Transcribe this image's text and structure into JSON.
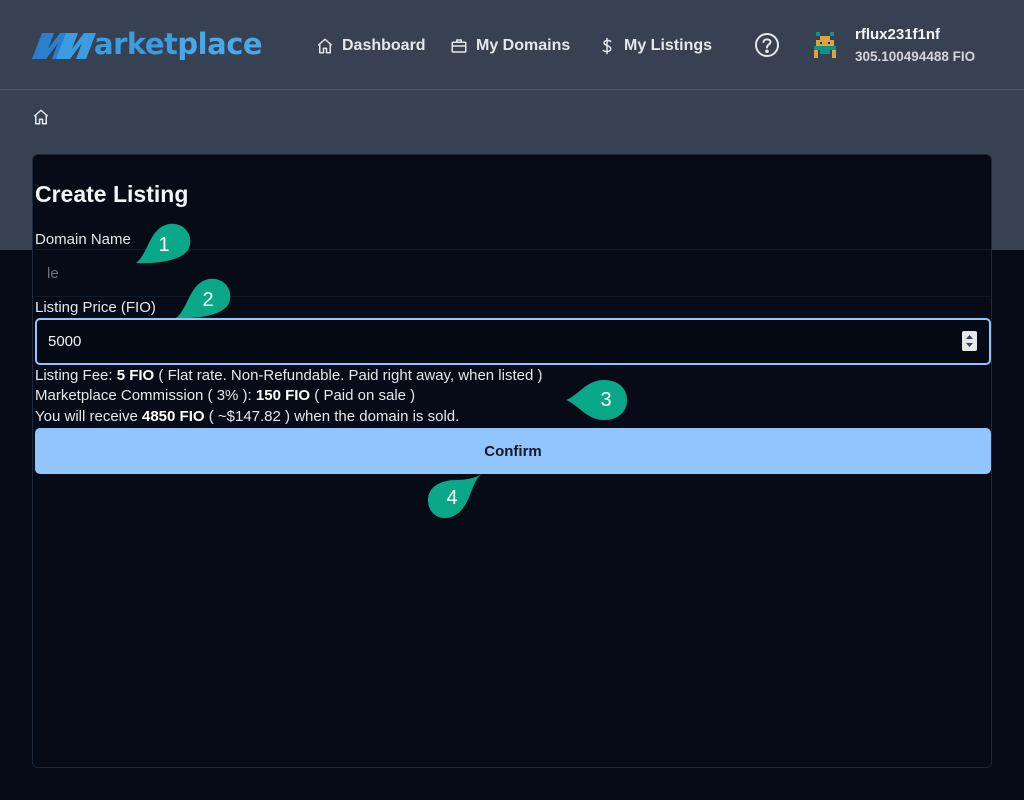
{
  "header": {
    "logo": {
      "text_bold": "arket",
      "text_rest": "place"
    },
    "nav": [
      {
        "label": "Dashboard",
        "icon": "home-icon"
      },
      {
        "label": "My Domains",
        "icon": "briefcase-icon"
      },
      {
        "label": "My Listings",
        "icon": "dollar-icon"
      }
    ],
    "help_icon": "help-circle-icon",
    "user": {
      "name": "rflux231f1nf",
      "balance": "305.100494488 FIO",
      "avatar_icon": "pixel-avatar-icon"
    }
  },
  "breadcrumb": {
    "icon": "home-icon"
  },
  "form": {
    "title": "Create Listing",
    "domain_label": "Domain Name",
    "domain_value": "le",
    "price_label": "Listing Price (FIO)",
    "price_value": "5000",
    "fee": {
      "prefix": "Listing Fee: ",
      "amount": "5 FIO",
      "suffix": " ( Flat rate. Non-Refundable. Paid right away, when listed )"
    },
    "commission": {
      "prefix": "Marketplace Commission ( 3% ): ",
      "amount": "150 FIO",
      "suffix": " ( Paid on sale )"
    },
    "receive": {
      "prefix": "You will receive ",
      "amount": "4850 FIO",
      "suffix": " ( ~$147.82 ) when the domain is sold."
    },
    "confirm_label": "Confirm"
  },
  "annotations": [
    "1",
    "2",
    "3",
    "4"
  ],
  "colors": {
    "header_bg": "#374151",
    "page_bg": "#060b17",
    "accent": "#93c5fd",
    "logo_blue": "#3b9ddf",
    "marker_green": "#0aa889"
  }
}
